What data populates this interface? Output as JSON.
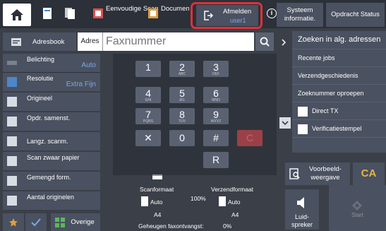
{
  "topbar": {
    "simple_scan": "Eenvoudige Scan",
    "doc_archive": "Document Archivering",
    "logout": "Afmelden",
    "user": "user1",
    "system_info": "Systeem informatie.",
    "job_status": "Opdracht Status"
  },
  "address": {
    "book_label": "Adresbook",
    "addr_label": "Adres",
    "fax_placeholder": "Faxnummer"
  },
  "settings": {
    "exposure": "Belichting",
    "exposure_val": "Auto",
    "resolution": "Resolutie",
    "resolution_val": "Extra Fijn",
    "original": "Origineel",
    "combine": "Opdr. samenst.",
    "long_scan": "Langz. scanm.",
    "heavy_paper": "Scan zwaar papier",
    "mixed": "Gemengd form.",
    "count": "Aantal originelen",
    "other": "Overige"
  },
  "keypad": [
    {
      "main": "1",
      "sub": ""
    },
    {
      "main": "2",
      "sub": "ABC"
    },
    {
      "main": "3",
      "sub": "DEF"
    },
    {
      "main": "4",
      "sub": "GHI"
    },
    {
      "main": "5",
      "sub": "JKL"
    },
    {
      "main": "6",
      "sub": "MNO"
    },
    {
      "main": "7",
      "sub": "PQRS"
    },
    {
      "main": "8",
      "sub": "TUV"
    },
    {
      "main": "9",
      "sub": "WXYZ"
    },
    {
      "main": "✕",
      "sub": ""
    },
    {
      "main": "0",
      "sub": ""
    },
    {
      "main": "#",
      "sub": ""
    },
    {
      "main": "C",
      "sub": ""
    },
    {
      "main": "R",
      "sub": ""
    }
  ],
  "right_panel": {
    "search_global": "Zoeken in alg. adressen",
    "recent_jobs": "Recente jobs",
    "send_history": "Verzendgeschiedenis",
    "search_number": "Zoeknummer oproepen",
    "direct_tx": "Direct TX",
    "verify_stamp": "Verificatiestempel"
  },
  "actions": {
    "preview": "Voorbeeld-weergave",
    "ca": "CA",
    "speaker": "Luid-spreker",
    "start": "Start"
  },
  "status": {
    "scan_format_label": "Scanformaat",
    "send_format_label": "Verzendformaat",
    "ratio": "100%",
    "scan_format": "Auto",
    "send_format": "Auto",
    "scan_paper": "A4",
    "send_paper": "A4",
    "memory": "Geheugen faxontvangst:",
    "memory_val": "0%"
  },
  "colors": {
    "highlight_border": "#e0303a",
    "user_text": "#7aa8e8",
    "ca_text": "#e3b642"
  }
}
